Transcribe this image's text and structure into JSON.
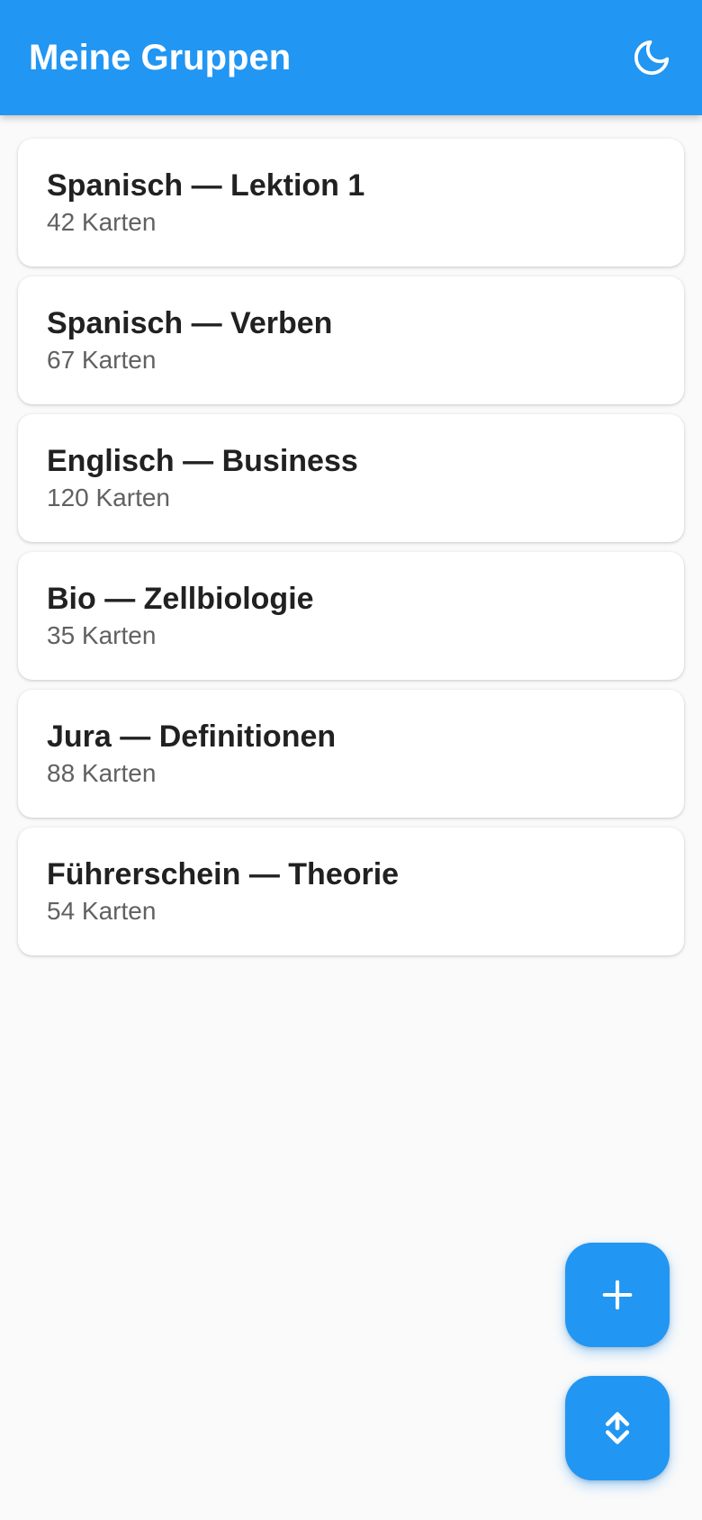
{
  "appbar": {
    "title": "Meine Gruppen",
    "theme_icon": "moon-icon"
  },
  "groups": [
    {
      "name": "Spanisch — Lektion 1",
      "count": "42 Karten"
    },
    {
      "name": "Spanisch — Verben",
      "count": "67 Karten"
    },
    {
      "name": "Englisch — Business",
      "count": "120 Karten"
    },
    {
      "name": "Bio — Zellbiologie",
      "count": "35 Karten"
    },
    {
      "name": "Jura — Definitionen",
      "count": "88 Karten"
    },
    {
      "name": "Führerschein — Theorie",
      "count": "54 Karten"
    }
  ],
  "fabs": {
    "add_icon": "plus-icon",
    "sort_icon": "sort-arrows-icon"
  },
  "colors": {
    "primary": "#2196f3",
    "background": "#fafafa",
    "card": "#ffffff",
    "title_text": "#212121",
    "secondary_text": "#616161"
  }
}
